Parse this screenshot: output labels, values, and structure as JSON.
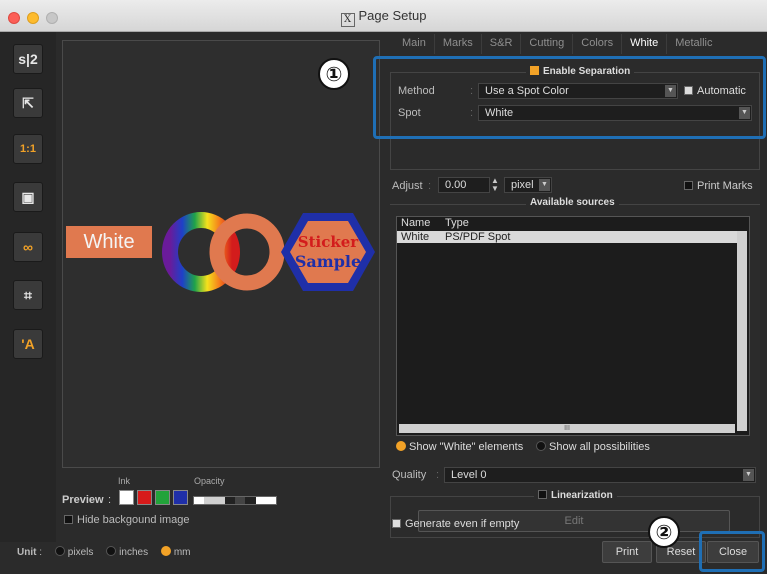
{
  "window": {
    "title": "Page Setup",
    "title_icon": "X"
  },
  "toolbar": {
    "items": [
      {
        "name": "sticker-split-tool",
        "glyph": "s|2"
      },
      {
        "name": "export-tool",
        "glyph": "⇱"
      },
      {
        "name": "actual-size-tool",
        "glyph": "1:1"
      },
      {
        "name": "fit-frame-tool",
        "glyph": "▣"
      },
      {
        "name": "link-tool",
        "glyph": "∞"
      },
      {
        "name": "crop-marks-tool",
        "glyph": "⌗"
      },
      {
        "name": "auto-text-tool",
        "glyph": "'A"
      }
    ]
  },
  "preview": {
    "white_label": "White",
    "sticker_text_1": "Sticker",
    "sticker_text_2": "Sample",
    "ink_label": "Ink",
    "opacity_label": "Opacity",
    "preview_label": "Preview",
    "hide_bg_label": "Hide backgound image",
    "swatches": [
      "#ffffff",
      "#d71a1a",
      "#22a33a",
      "#1f2fa8"
    ],
    "opacity_steps": [
      "#ffffff",
      "#d0d0d0",
      "#d0d0d0",
      "#222222",
      "#444444",
      "#222222",
      "#ffffff",
      "#ffffff"
    ]
  },
  "units": {
    "label": "Unit",
    "options": [
      "pixels",
      "inches",
      "mm"
    ],
    "selected": "mm"
  },
  "tabs": [
    "Main",
    "Marks",
    "S&R",
    "Cutting",
    "Colors",
    "White",
    "Metallic"
  ],
  "active_tab": "White",
  "separation": {
    "enable_label": "Enable Separation",
    "method_label": "Method",
    "method_value": "Use a Spot Color",
    "automatic_label": "Automatic",
    "spot_label": "Spot",
    "spot_value": "White"
  },
  "adjust": {
    "label": "Adjust",
    "value": "0.00",
    "unit": "pixel",
    "print_marks_label": "Print Marks"
  },
  "sources": {
    "title": "Available sources",
    "col_name": "Name",
    "col_type": "Type",
    "rows": [
      {
        "name": "White",
        "type": "PS/PDF Spot"
      }
    ],
    "scroll_glyph": "III"
  },
  "show_options": {
    "show_white": "Show \"White\" elements",
    "show_all": "Show all possibilities"
  },
  "quality": {
    "label": "Quality",
    "value": "Level 0"
  },
  "linearization": {
    "label": "Linearization",
    "edit_label": "Edit"
  },
  "generate_label": "Generate even if empty",
  "buttons": {
    "print": "Print",
    "reset": "Reset",
    "close": "Close"
  },
  "callouts": {
    "one": "①",
    "two": "②"
  },
  "colors": {
    "accent": "#f2a227",
    "callout": "#1f6fb5",
    "label_orange": "#e0794f"
  }
}
